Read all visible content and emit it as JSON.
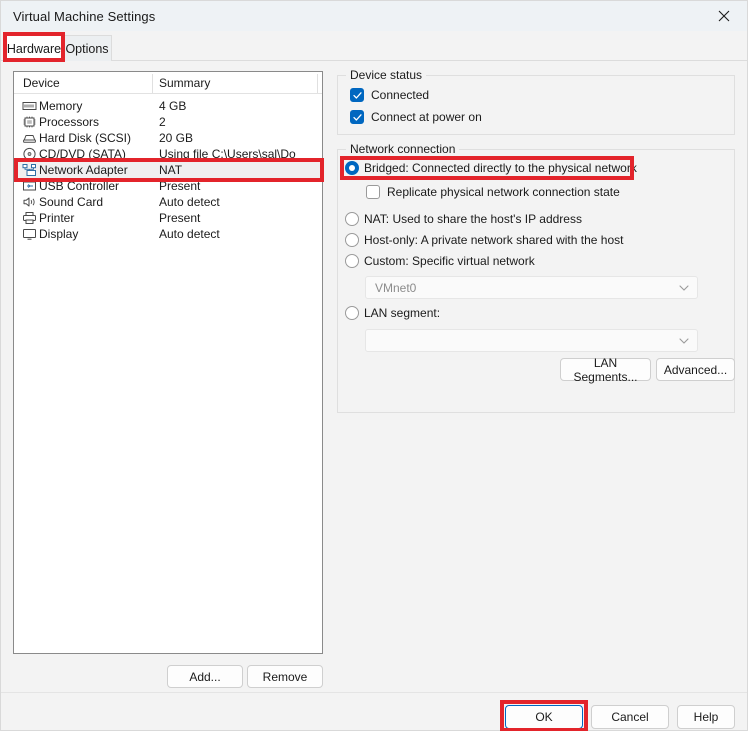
{
  "window": {
    "title": "Virtual Machine Settings",
    "close_icon": "close-icon"
  },
  "tabs": [
    {
      "label": "Hardware",
      "active": true
    },
    {
      "label": "Options",
      "active": false
    }
  ],
  "device_list": {
    "headers": {
      "device": "Device",
      "summary": "Summary"
    },
    "rows": [
      {
        "icon": "memory-icon",
        "name": "Memory",
        "summary": "4 GB",
        "selected": false
      },
      {
        "icon": "processor-icon",
        "name": "Processors",
        "summary": "2",
        "selected": false
      },
      {
        "icon": "hard-disk-icon",
        "name": "Hard Disk (SCSI)",
        "summary": "20 GB",
        "selected": false
      },
      {
        "icon": "cd-dvd-icon",
        "name": "CD/DVD (SATA)",
        "summary": "Using file C:\\Users\\sal\\Do",
        "selected": false
      },
      {
        "icon": "network-adapter-icon",
        "name": "Network Adapter",
        "summary": "NAT",
        "selected": true
      },
      {
        "icon": "usb-controller-icon",
        "name": "USB Controller",
        "summary": "Present",
        "selected": false
      },
      {
        "icon": "sound-card-icon",
        "name": "Sound Card",
        "summary": "Auto detect",
        "selected": false
      },
      {
        "icon": "printer-icon",
        "name": "Printer",
        "summary": "Present",
        "selected": false
      },
      {
        "icon": "display-icon",
        "name": "Display",
        "summary": "Auto detect",
        "selected": false
      }
    ],
    "add_label": "Add...",
    "remove_label": "Remove"
  },
  "device_status": {
    "title": "Device status",
    "connected": {
      "label": "Connected",
      "checked": true
    },
    "connect_at_power_on": {
      "label": "Connect at power on",
      "checked": true
    }
  },
  "network_connection": {
    "title": "Network connection",
    "options": [
      {
        "label": "Bridged: Connected directly to the physical network",
        "selected": true
      },
      {
        "label": "NAT: Used to share the host's IP address",
        "selected": false
      },
      {
        "label": "Host-only: A private network shared with the host",
        "selected": false
      },
      {
        "label": "Custom: Specific virtual network",
        "selected": false
      },
      {
        "label": "LAN segment:",
        "selected": false
      }
    ],
    "replicate": {
      "label": "Replicate physical network connection state",
      "checked": false
    },
    "custom_network_value": "VMnet0",
    "lan_segment_value": "",
    "lan_segments_button": "LAN Segments...",
    "advanced_button": "Advanced..."
  },
  "footer": {
    "ok": "OK",
    "cancel": "Cancel",
    "help": "Help"
  },
  "colors": {
    "accent": "#0067c0",
    "highlight": "#e3242b",
    "window_bg": "#f3f3f3",
    "titlebar_bg": "#eef2f5"
  }
}
